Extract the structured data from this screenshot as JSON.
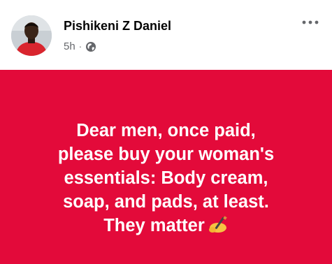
{
  "post": {
    "author_name": "Pishikeni Z Daniel",
    "timestamp": "5h",
    "separator": "·",
    "privacy_icon": "globe-icon",
    "more_icon": "more-options-icon",
    "background_color": "#e30a3a",
    "text_color": "#ffffff",
    "lines": [
      "Dear men, once paid,",
      "please buy your woman's",
      "essentials: Body cream,",
      "soap, and pads, at least.",
      "They matter"
    ],
    "trailing_emoji": "writing-hand-emoji"
  }
}
